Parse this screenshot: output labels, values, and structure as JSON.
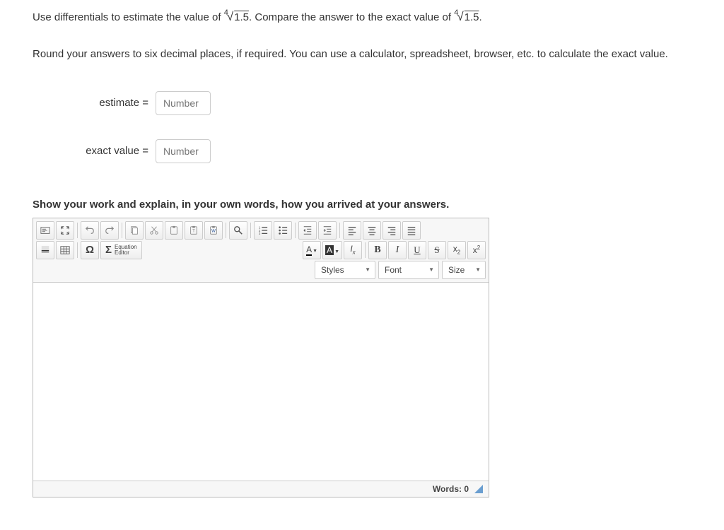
{
  "question": {
    "part1": "Use differentials to estimate the value of ",
    "root_index": "4",
    "radicand": "1.5",
    "part2": ". Compare the answer to the exact value of ",
    "part3": "."
  },
  "instructions": "Round your answers to six decimal places, if required. You can use a calculator, spreadsheet, browser, etc. to calculate the exact value.",
  "inputs": {
    "estimate_label": "estimate =",
    "exact_label": "exact value =",
    "placeholder": "Number"
  },
  "prompt": "Show your work and explain, in your own words, how you arrived at your answers.",
  "editor": {
    "equation_label_top": "Equation",
    "equation_label_bottom": "Editor",
    "styles": "Styles",
    "font": "Font",
    "size": "Size",
    "words_label": "Words: 0"
  }
}
